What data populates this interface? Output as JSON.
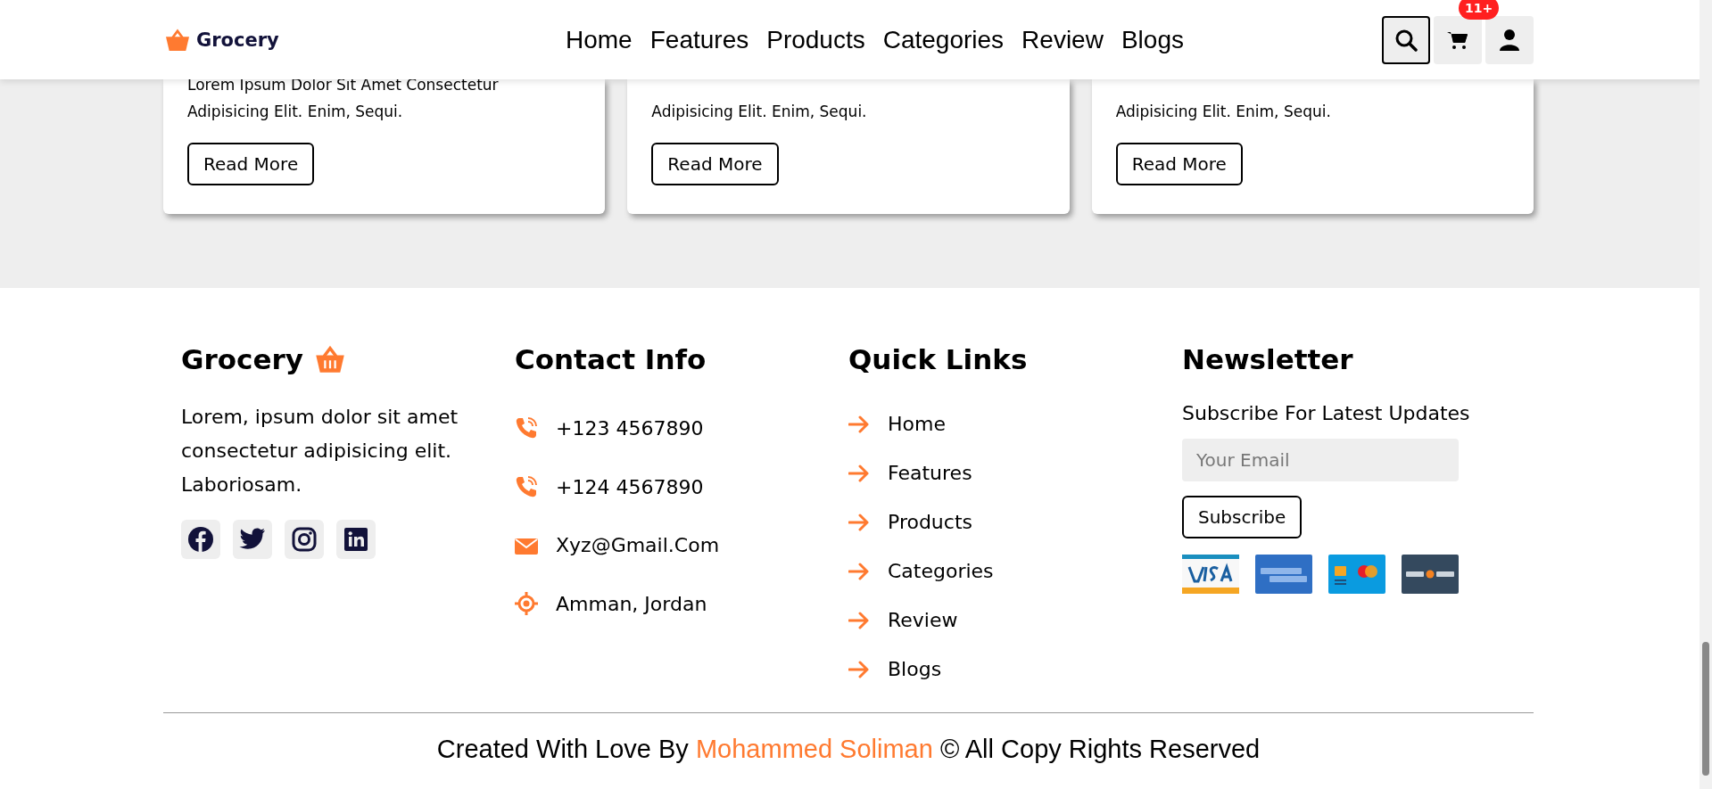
{
  "header": {
    "logo": "Grocery",
    "nav": [
      "Home",
      "Features",
      "Products",
      "Categories",
      "Review",
      "Blogs"
    ],
    "cart_badge": "11+",
    "search_selected": true
  },
  "blog_cards": [
    {
      "text": "Lorem Ipsum Dolor Sit Amet Consectetur Adipisicing Elit. Enim, Sequi.",
      "button": "Read More"
    },
    {
      "text": "Adipisicing Elit. Enim, Sequi.",
      "button": "Read More"
    },
    {
      "text": "Adipisicing Elit. Enim, Sequi.",
      "button": "Read More"
    }
  ],
  "footer": {
    "brand": {
      "title": "Grocery",
      "text": "Lorem, ipsum dolor sit amet consectetur adipisicing elit. Laboriosam.",
      "socials": [
        {
          "kind": "facebook"
        },
        {
          "kind": "twitter"
        },
        {
          "kind": "instagram"
        },
        {
          "kind": "linkedin"
        }
      ]
    },
    "contact": {
      "title": "Contact Info",
      "items": [
        {
          "kind": "phone",
          "text": "+123 4567890"
        },
        {
          "kind": "phone",
          "text": "+124 4567890"
        },
        {
          "kind": "email",
          "text": "Xyz@Gmail.Com"
        },
        {
          "kind": "location",
          "text": "Amman, Jordan"
        }
      ]
    },
    "quick_links": {
      "title": "Quick Links",
      "links": [
        "Home",
        "Features",
        "Products",
        "Categories",
        "Review",
        "Blogs"
      ]
    },
    "newsletter": {
      "title": "Newsletter",
      "subtitle": "Subscribe For Latest Updates",
      "email_placeholder": "Your Email",
      "button": "Subscribe",
      "cards": [
        {
          "kind": "visa"
        },
        {
          "kind": "amex"
        },
        {
          "kind": "mastercard"
        },
        {
          "kind": "discover"
        }
      ]
    },
    "credit": {
      "before": "Created With Love By",
      "author": "Mohammed Soliman",
      "after": "© All Copy Rights Reserved"
    }
  }
}
